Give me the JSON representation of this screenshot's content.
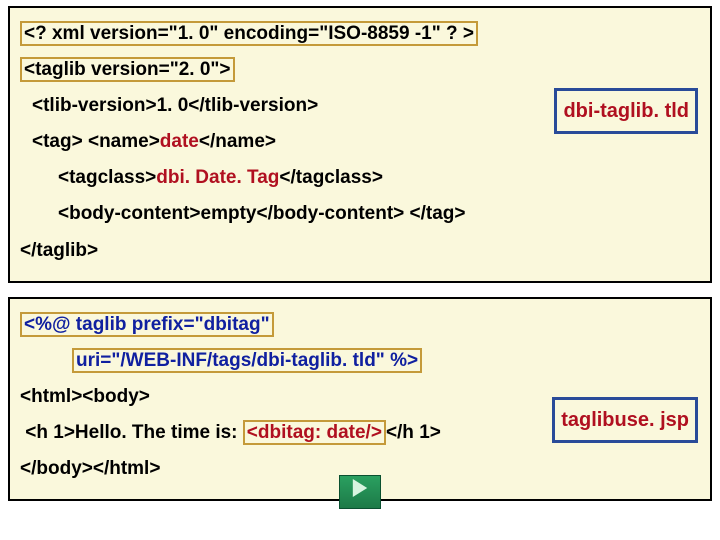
{
  "block1": {
    "file_label": "dbi-taglib. tld",
    "lines": {
      "l1_a": "<? xml version=\"1. 0\" encoding=\"ISO-8859 -1\" ? >",
      "l2_a": "<taglib version=\"2. 0\">",
      "l3_a": "<tlib-version>1. 0</tlib-version>",
      "l4_a": "<tag> <name>",
      "l4_b": "date",
      "l4_c": "</name>",
      "l5_a": "<tagclass>",
      "l5_b": "dbi. Date. Tag",
      "l5_c": "</tagclass>",
      "l6_a": "<body-content>empty</body-content> </tag>",
      "l7_a": "</taglib>"
    }
  },
  "block2": {
    "file_label": "taglibuse. jsp",
    "lines": {
      "l1_a": "<%@ taglib prefix=\"dbitag\"",
      "l2_a": "uri=\"/WEB-INF/tags/dbi-taglib. tld\" %>",
      "l3_a": "<html><body>",
      "l4_a": " <h 1>Hello. The time is: ",
      "l4_b": "<dbitag: date/>",
      "l4_c": "</h 1>",
      "l5_a": "</body></html>"
    }
  },
  "icons": {
    "next": "next-slide"
  }
}
